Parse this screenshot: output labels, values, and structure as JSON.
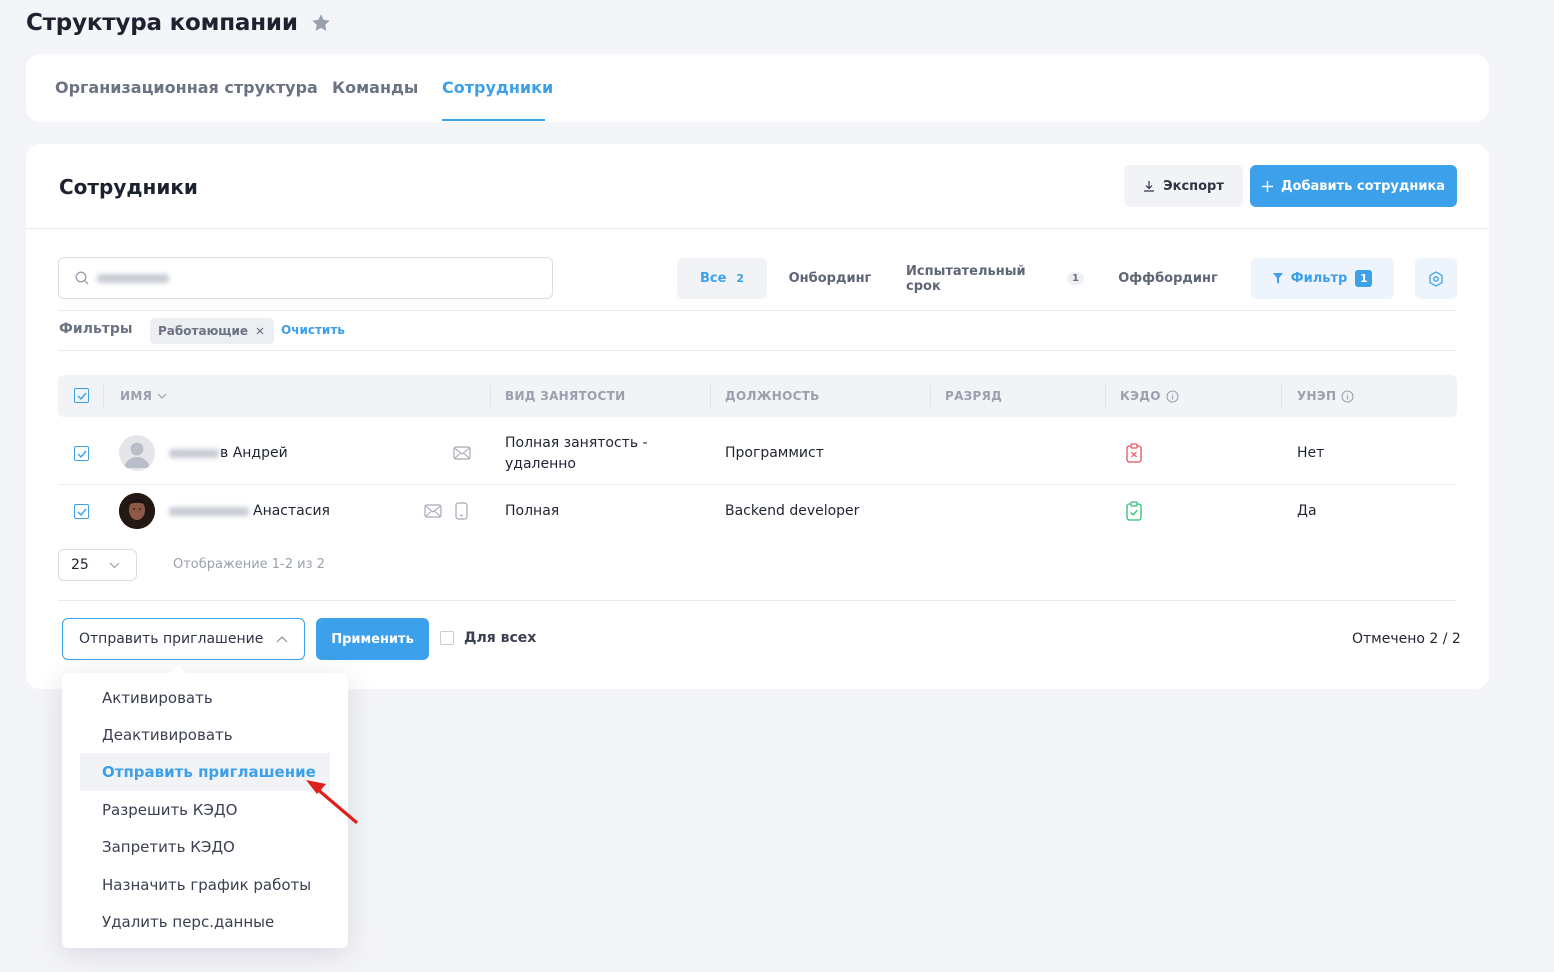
{
  "page": {
    "title": "Структура компании"
  },
  "tabs": [
    {
      "label": "Организационная структура"
    },
    {
      "label": "Команды"
    },
    {
      "label": "Сотрудники",
      "active": true
    }
  ],
  "section": {
    "title": "Сотрудники",
    "export_label": "Экспорт",
    "add_label": "Добавить сотрудника"
  },
  "segments": [
    {
      "label": "Все",
      "count": "2",
      "active": true
    },
    {
      "label": "Онбординг",
      "count": ""
    },
    {
      "label": "Испытательный срок",
      "count": "1"
    },
    {
      "label": "Оффбординг",
      "count": ""
    }
  ],
  "filter_button": {
    "label": "Фильтр",
    "count": "1"
  },
  "filters": {
    "label": "Фильтры",
    "chips": [
      {
        "label": "Работающие"
      }
    ],
    "clear_label": "Очистить"
  },
  "table": {
    "columns": [
      "ИМЯ",
      "ВИД ЗАНЯТОСТИ",
      "ДОЛЖНОСТЬ",
      "РАЗРЯД",
      "КЭДО",
      "УНЭП"
    ],
    "rows": [
      {
        "name": "в Андрей",
        "employment": "Полная занятость - удаленно",
        "position": "Программист",
        "grade": "",
        "kedo": "denied",
        "unep": "Нет",
        "checked": true
      },
      {
        "name": "Анастасия",
        "employment": "Полная",
        "position": "Backend developer",
        "grade": "",
        "kedo": "allowed",
        "unep": "Да",
        "checked": true
      }
    ]
  },
  "pagination": {
    "page_size": "25",
    "info": "Отображение 1-2 из 2"
  },
  "bulk_actions": {
    "selected_action": "Отправить приглашение",
    "apply_label": "Применить",
    "for_all_label": "Для всех",
    "selected_count": "Отмечено 2 / 2",
    "options": [
      {
        "label": "Активировать"
      },
      {
        "label": "Деактивировать"
      },
      {
        "label": "Отправить приглашение",
        "active": true
      },
      {
        "label": "Разрешить КЭДО"
      },
      {
        "label": "Запретить КЭДО"
      },
      {
        "label": "Назначить график работы"
      },
      {
        "label": "Удалить перс.данные"
      }
    ]
  },
  "colors": {
    "accent": "#3da0ea",
    "kedo_denied": "#e8505b",
    "kedo_allowed": "#2fbf71",
    "annotation_arrow": "#e0201b"
  }
}
